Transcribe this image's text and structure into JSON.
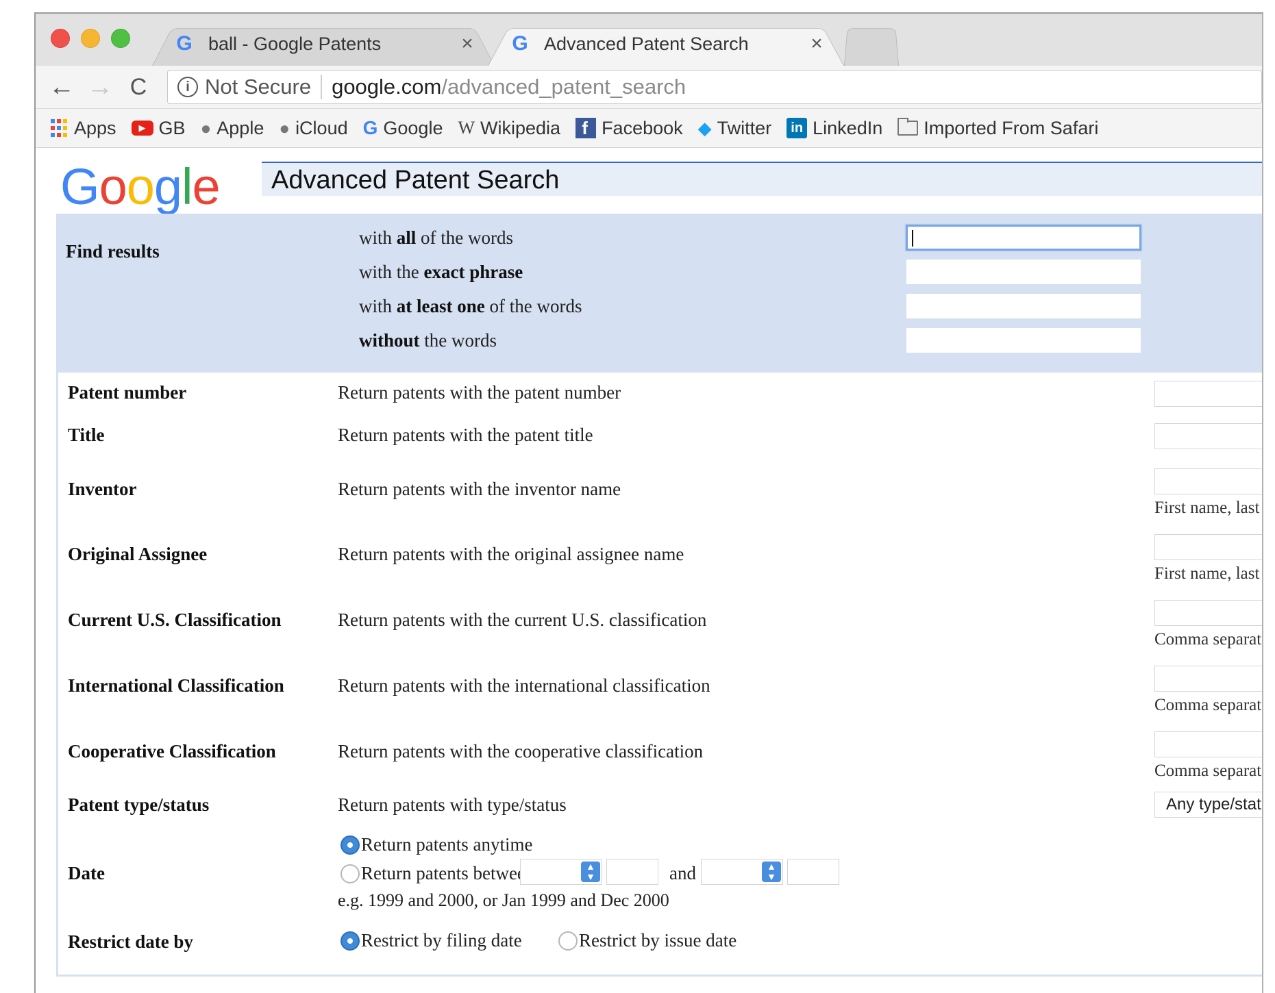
{
  "browser": {
    "tabs": [
      {
        "title": "ball - Google Patents",
        "close": "×"
      },
      {
        "title": "Advanced Patent Search",
        "close": "×"
      }
    ],
    "nav": {
      "back": "←",
      "forward": "→",
      "reload": "C"
    },
    "address": {
      "security": "Not Secure",
      "host": "google.com",
      "path": "/advanced_patent_search"
    },
    "bookmarks": [
      {
        "label": "Apps",
        "icon": "apps-grid-icon"
      },
      {
        "label": "GB",
        "icon": "youtube-icon"
      },
      {
        "label": "Apple",
        "icon": "apple-icon"
      },
      {
        "label": "iCloud",
        "icon": "apple-icon"
      },
      {
        "label": "Google",
        "icon": "google-icon"
      },
      {
        "label": "Wikipedia",
        "icon": "wikipedia-icon"
      },
      {
        "label": "Facebook",
        "icon": "facebook-icon"
      },
      {
        "label": "Twitter",
        "icon": "twitter-icon"
      },
      {
        "label": "LinkedIn",
        "icon": "linkedin-icon"
      },
      {
        "label": "Imported From Safari",
        "icon": "folder-icon"
      }
    ]
  },
  "page": {
    "logo": {
      "l1": "G",
      "l2": "o",
      "l3": "o",
      "l4": "g",
      "l5": "l",
      "l6": "e"
    },
    "title": "Advanced Patent Search",
    "find_results": {
      "label": "Find results",
      "rows": [
        {
          "pre": "with ",
          "bold": "all",
          "post": " of the words"
        },
        {
          "pre": "with the ",
          "bold": "exact phrase",
          "post": ""
        },
        {
          "pre": "with ",
          "bold": "at least one",
          "post": " of the words"
        },
        {
          "pre": "",
          "bold": "without",
          "post": " the words"
        }
      ]
    },
    "options": [
      {
        "label": "Patent number",
        "desc": "Return patents with the patent number",
        "hint": ""
      },
      {
        "label": "Title",
        "desc": "Return patents with the patent title",
        "hint": ""
      },
      {
        "label": "Inventor",
        "desc": "Return patents with the inventor name",
        "hint": "First name, last"
      },
      {
        "label": "Original Assignee",
        "desc": "Return patents with the original assignee name",
        "hint": "First name, last"
      },
      {
        "label": "Current U.S. Classification",
        "desc": "Return patents with the current U.S. classification",
        "hint": "Comma separate"
      },
      {
        "label": "International Classification",
        "desc": "Return patents with the international classification",
        "hint": "Comma separate"
      },
      {
        "label": "Cooperative Classification",
        "desc": "Return patents with the cooperative classification",
        "hint": "Comma separate"
      },
      {
        "label": "Patent type/status",
        "desc": "Return patents with type/status",
        "select": "Any type/status"
      }
    ],
    "date": {
      "label": "Date",
      "anytime": "Return patents anytime",
      "between": "Return patents between",
      "and": "and",
      "example": "e.g. 1999 and 2000, or Jan 1999 and Dec 2000"
    },
    "restrict": {
      "label": "Restrict date by",
      "filing": "Restrict by filing date",
      "issue": "Restrict by issue date"
    }
  },
  "colors": {
    "accent": "#3366cc",
    "find_bg": "#d5e0f2",
    "radio_on": "#3f8bd8"
  }
}
